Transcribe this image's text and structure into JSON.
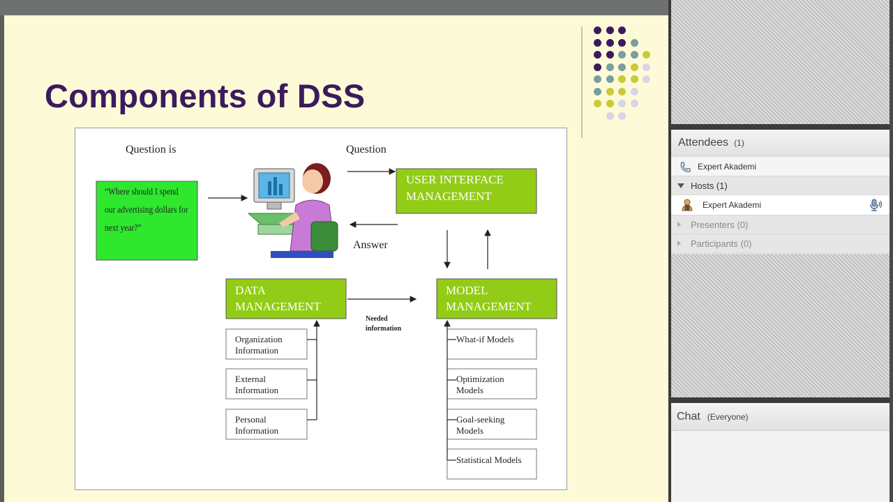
{
  "slide": {
    "title": "Components of DSS",
    "accent_color": "#3c1a5e",
    "dot_colors": [
      "#3c1a5e",
      "#7a9e9f",
      "#c9c93a",
      "#d9d4e6"
    ]
  },
  "diagram": {
    "question_is_label": "Question is",
    "question_label": "Question",
    "answer_label": "Answer",
    "needed_info_label_1": "Needed",
    "needed_info_label_2": "information",
    "question_text_1": "“Where should I spend",
    "question_text_2": "our advertising dollars for",
    "question_text_3": "next year?”",
    "ui_box_1": "USER INTERFACE",
    "ui_box_2": "MANAGEMENT",
    "data_box_1": "DATA",
    "data_box_2": "MANAGEMENT",
    "model_box_1": "MODEL",
    "model_box_2": "MANAGEMENT",
    "data_items": [
      [
        "Organization",
        "Information"
      ],
      [
        "External",
        "Information"
      ],
      [
        "Personal",
        "Information"
      ]
    ],
    "model_items": [
      [
        "What-if Models",
        ""
      ],
      [
        "Optimization",
        "Models"
      ],
      [
        "Goal-seeking",
        "Models"
      ],
      [
        "Statistical Models",
        ""
      ]
    ],
    "colors": {
      "question_box": "#2ee82e",
      "mgmt_box": "#92cc16",
      "box_border": "#555555"
    }
  },
  "attendees": {
    "title": "Attendees",
    "count": "(1)",
    "dial_in_name": "Expert Akademi",
    "hosts_label": "Hosts (1)",
    "host_name": "Expert Akademi",
    "presenters_label": "Presenters (0)",
    "participants_label": "Participants (0)"
  },
  "chat": {
    "title": "Chat",
    "scope": "(Everyone)"
  }
}
